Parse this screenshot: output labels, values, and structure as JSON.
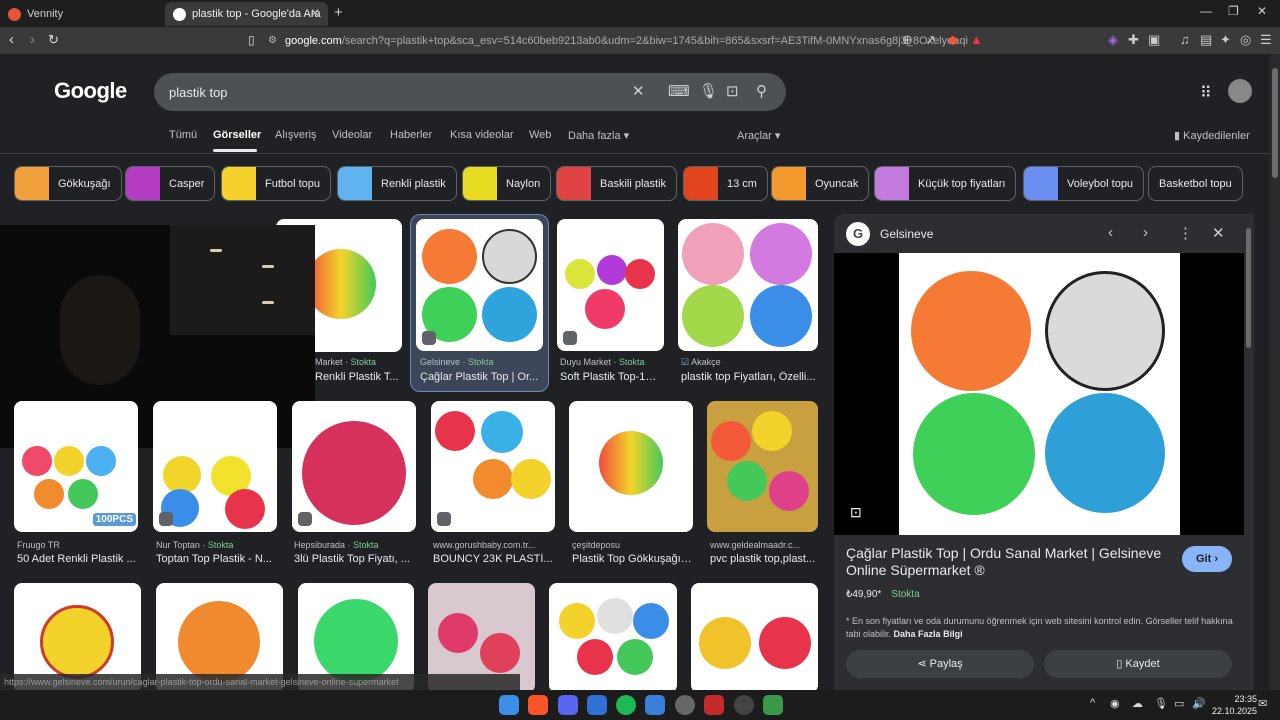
{
  "browser": {
    "tabs": [
      {
        "title": "Vennity",
        "favicon_color": "#e5533d"
      },
      {
        "title": "plastik top - Google'da Ara",
        "favicon_color": "#ffffff"
      }
    ],
    "url_host": "google.com",
    "url_rest": "/search?q=plastik+top&sca_esv=514c60beb9213ab0&udm=2&biw=1745&bih=865&sxsrf=AE3TifM-0MNYxnas6g8j3_8Oxelydaqig..."
  },
  "google": {
    "logo": "Google",
    "query": "plastik top",
    "tabs": [
      "Tümü",
      "Görseller",
      "Alışveriş",
      "Videolar",
      "Haberler",
      "Kısa videolar",
      "Web",
      "Daha fazla ▾"
    ],
    "tools": "Araçlar ▾",
    "saved": "Kaydedilenler"
  },
  "chips": [
    {
      "label": "Gökkuşağı",
      "color": "#f2a03d"
    },
    {
      "label": "Casper",
      "color": "#b53cc4"
    },
    {
      "label": "Futbol topu",
      "color": "#f4d22b"
    },
    {
      "label": "Renkli plastik",
      "color": "#5fb3f0"
    },
    {
      "label": "Naylon",
      "color": "#e8dc22"
    },
    {
      "label": "Baskili plastik",
      "color": "#e04343"
    },
    {
      "label": "13 cm",
      "color": "#e3461f"
    },
    {
      "label": "Oyuncak",
      "color": "#f29a2e"
    },
    {
      "label": "Küçük top fiyatları",
      "color": "#c57ae0"
    },
    {
      "label": "Voleybol topu",
      "color": "#6a8ef0"
    },
    {
      "label": "Basketbol topu",
      "color": ""
    }
  ],
  "results_row1": [
    {
      "source": "Market · ",
      "stock": "Stokta",
      "title": "Renkli Plastik T..."
    },
    {
      "source": "Gelsineve · ",
      "stock": "Stokta",
      "title": "Çağlar Plastik Top | Or..."
    },
    {
      "source": "Duyu Market · ",
      "stock": "Stokta",
      "title": "Soft Plastik Top-10..."
    },
    {
      "source": "Akakçe",
      "stock": "",
      "title": "plastik top Fiyatları, Özelli..."
    }
  ],
  "results_row2": [
    {
      "source": "Fruugo TR",
      "stock": "",
      "title": "50 Adet Renkli Plastik ..."
    },
    {
      "source": "Nur Toptan · ",
      "stock": "Stokta",
      "title": "Toptan Top Plastik - N..."
    },
    {
      "source": "Hepsiburada · ",
      "stock": "Stokta",
      "title": "3lü Plastik Top Fiyatı, ..."
    },
    {
      "source": "www.gorushbaby.com.tr...",
      "stock": "",
      "title": "BOUNCY 23K PLASTİ..."
    },
    {
      "source": "çeşitdeposu",
      "stock": "",
      "title": "Plastik Top Gökkuşağı ..."
    },
    {
      "source": "www.geldealmaadr.c...",
      "stock": "",
      "title": "pvc plastik top,plast..."
    }
  ],
  "badge_100pcs": "100PCS",
  "panel": {
    "site": "Gelsineve",
    "title": "Çağlar Plastik Top | Ordu Sanal Market | Gelsineve Online Süpermarket ®",
    "visit": "Git ›",
    "price": "₺49,90*",
    "stock": "Stokta",
    "note": "* En son fiyatları ve oda durumunu öğrenmek için web sitesini kontrol edin. Görseller telif hakkına tabi olabilir.",
    "more_info": "Daha Fazla Bilgi",
    "share": "Paylaş",
    "save": "Kaydet"
  },
  "status_url": "https://www.gelsineve.com/urun/caglar-plastik-top-ordu-sanal-market-gelsineve-online-supermarket",
  "taskbar": {
    "time": "23:35",
    "date": "22.10.2025"
  }
}
